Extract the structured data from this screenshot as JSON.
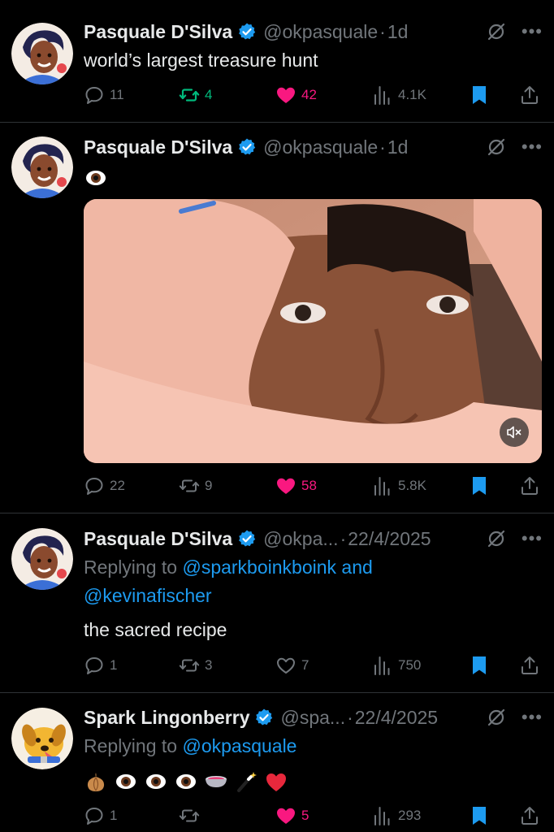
{
  "colors": {
    "background": "#000000",
    "text": "#e7e9ea",
    "muted": "#71767b",
    "link": "#1d9bf0",
    "verified": "#1d9bf0",
    "repost_active": "#00ba7c",
    "like_active": "#f91880",
    "divider": "#2f3336"
  },
  "icons": {
    "verified": "verified-badge-icon",
    "grok": "grok-icon",
    "more": "more-icon",
    "reply": "reply-icon",
    "repost": "repost-icon",
    "like": "heart-icon",
    "views": "views-icon",
    "bookmark": "bookmark-icon",
    "share": "share-icon",
    "mute": "volume-muted-icon"
  },
  "tweets": [
    {
      "author": "Pasquale D'Silva",
      "handle": "@okpasquale",
      "separator": "·",
      "time": "1d",
      "text": "world’s largest treasure hunt",
      "replies": "11",
      "reposts": "4",
      "likes": "42",
      "views": "4.1K",
      "reposted": true,
      "liked": true,
      "bookmarked": true
    },
    {
      "author": "Pasquale D'Silva",
      "handle": "@okpasquale",
      "separator": "·",
      "time": "1d",
      "text_emoji": [
        "eyes"
      ],
      "media": "video",
      "muted": true,
      "replies": "22",
      "reposts": "9",
      "likes": "58",
      "views": "5.8K",
      "reposted": false,
      "liked": true,
      "bookmarked": true
    },
    {
      "author": "Pasquale D'Silva",
      "handle": "@okpa...",
      "separator": "·",
      "time": "22/4/2025",
      "replying_prefix": "Replying to",
      "replying_to": [
        "@sparkboinkboink",
        "@kevinafischer"
      ],
      "replying_joiner": "and",
      "text": "the sacred recipe",
      "replies": "1",
      "reposts": "3",
      "likes": "7",
      "views": "750",
      "reposted": false,
      "liked": false,
      "bookmarked": true
    },
    {
      "author": "Spark Lingonberry",
      "handle": "@spa...",
      "separator": "·",
      "time": "22/4/2025",
      "replying_prefix": "Replying to",
      "replying_to": [
        "@okpasquale"
      ],
      "text_emoji": [
        "onion",
        "eyes",
        "eyes",
        "eyes",
        "pot",
        "magic-wand",
        "red-heart"
      ],
      "replies": "1",
      "reposts": "",
      "likes": "5",
      "views": "293",
      "reposted": false,
      "liked": true,
      "bookmarked": true
    }
  ]
}
